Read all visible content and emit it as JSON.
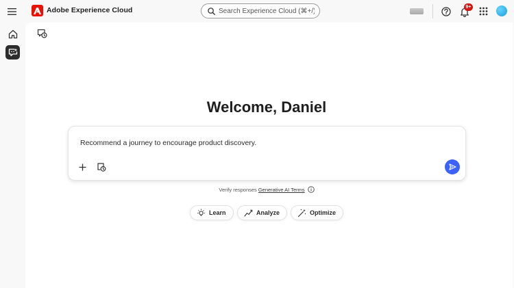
{
  "header": {
    "brand": "Adobe Experience Cloud",
    "search_placeholder": "Search Experience Cloud (⌘+/)",
    "notification_count": "9+",
    "icons": [
      "menu-icon",
      "adobe-logo",
      "search-icon",
      "help-icon",
      "bell-icon",
      "apps-grid-icon",
      "avatar"
    ]
  },
  "rail": {
    "items": [
      {
        "name": "home",
        "icon": "home-icon"
      },
      {
        "name": "ai-assistant",
        "icon": "chat-sparkle-icon",
        "active": true
      }
    ]
  },
  "main": {
    "welcome": "Welcome, Daniel",
    "prompt_text": "Recommend a journey to encourage product discovery.",
    "verify_text": "Verify responses",
    "terms_link": "Generative AI Terms",
    "chips": [
      {
        "label": "Learn",
        "icon": "lightbulb-icon"
      },
      {
        "label": "Analyze",
        "icon": "trend-line-icon"
      },
      {
        "label": "Optimize",
        "icon": "magic-wand-icon"
      }
    ]
  },
  "colors": {
    "accent_blue": "#3b63fb",
    "adobe_red": "#eb1000",
    "badge_red": "#d31510",
    "avatar_blue": "#1d9ed8",
    "background": "#f8f8f8",
    "panel": "#ffffff"
  }
}
